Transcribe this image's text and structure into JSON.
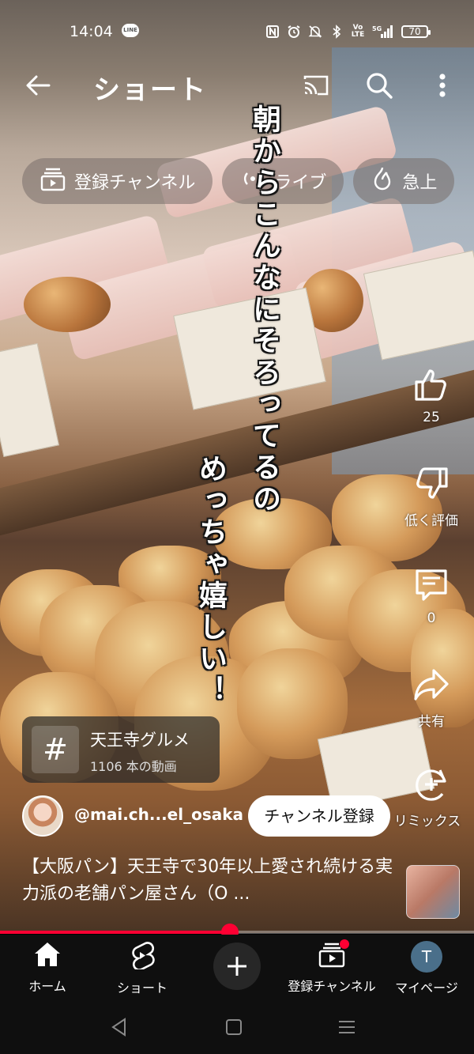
{
  "status_bar": {
    "time": "14:04",
    "line_badge": "LINE",
    "battery": "70",
    "icons": [
      "nfc-icon",
      "alarm-icon",
      "mute-icon",
      "bluetooth-icon",
      "volte-icon",
      "signal-5g-icon",
      "battery-icon"
    ],
    "volte": "Vo LTE",
    "network": "5G"
  },
  "topbar": {
    "title": "ショート",
    "icons": [
      "back-arrow-icon",
      "cast-icon",
      "search-icon",
      "more-vert-icon"
    ]
  },
  "chips": [
    {
      "label": "登録チャンネル",
      "icon": "subscriptions-icon"
    },
    {
      "label": "ライブ",
      "icon": "live-icon"
    },
    {
      "label": "急上",
      "icon": "trending-icon"
    }
  ],
  "caption": {
    "line1": "朝からこんなにそろってるの",
    "line2": "めっちゃ嬉しい！"
  },
  "actions": {
    "like_count": "25",
    "dislike_label": "低く評価",
    "comment_count": "0",
    "share_label": "共有",
    "remix_label": "リミックス"
  },
  "hashtag": {
    "symbol": "#",
    "name": "天王寺グルメ",
    "count": "1106 本の動画"
  },
  "channel": {
    "handle": "@mai.ch...el_osaka",
    "subscribe_label": "チャンネル登録"
  },
  "video": {
    "title": "【大阪パン】天王寺で30年以上愛され続ける実力派の老舗パン屋さん（O ..."
  },
  "progress": {
    "fraction": 0.485
  },
  "bottom_nav": {
    "home": "ホーム",
    "shorts": "ショート",
    "create_icon": "plus-icon",
    "subscriptions": "登録チャンネル",
    "me": "マイページ",
    "me_initial": "T"
  },
  "system_nav": [
    "back-triangle-icon",
    "home-square-icon",
    "recents-menu-icon"
  ],
  "colors": {
    "accent": "#ff0033",
    "nav_bg": "#0f0f0f",
    "subscribe_bg": "#ffffff"
  }
}
